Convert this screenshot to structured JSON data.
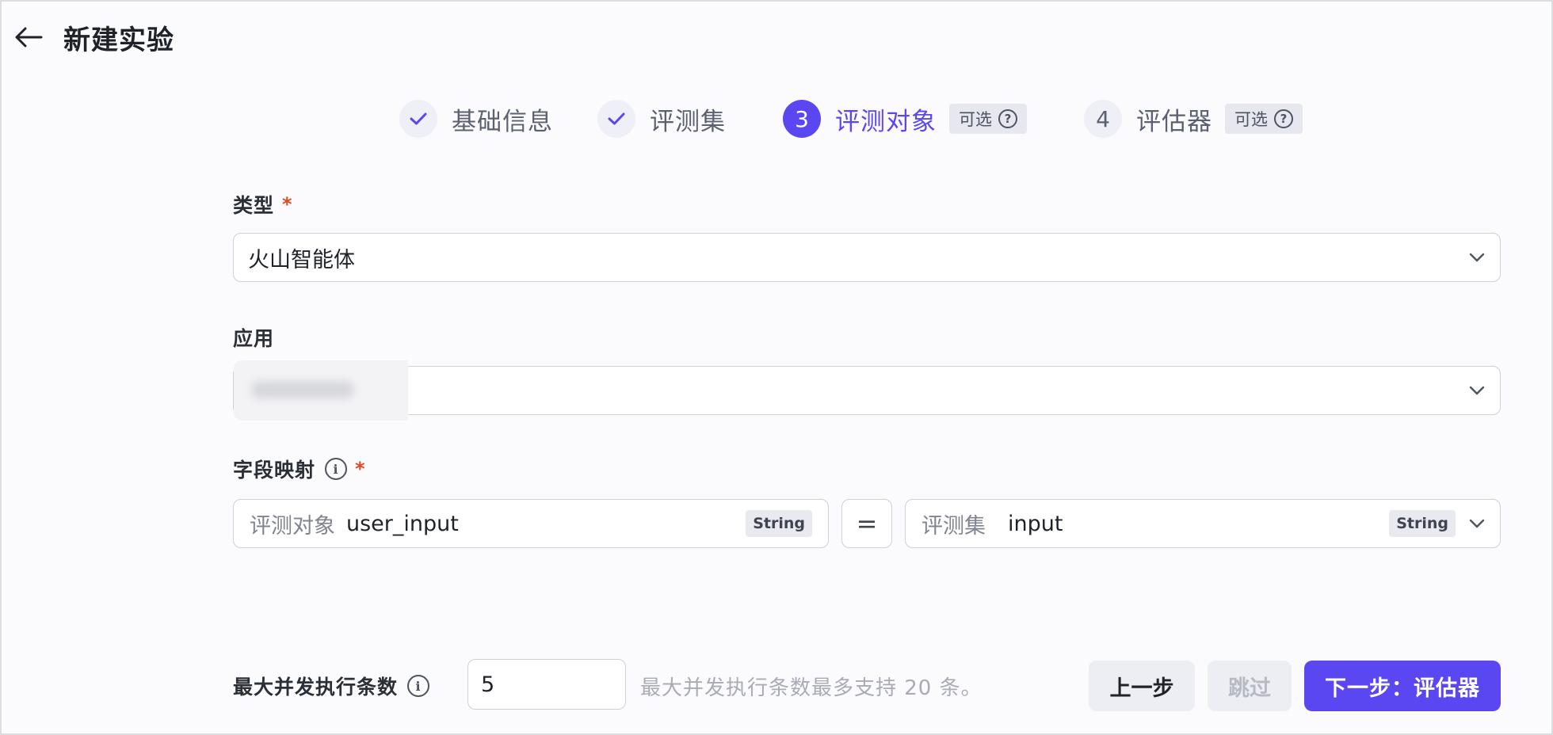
{
  "header": {
    "title": "新建实验",
    "back_icon": "arrow-left-icon"
  },
  "steps": [
    {
      "label": "基础信息",
      "state": "done",
      "marker": ""
    },
    {
      "label": "评测集",
      "state": "done",
      "marker": ""
    },
    {
      "label": "评测对象",
      "state": "active",
      "marker": "3",
      "optional": "可选"
    },
    {
      "label": "评估器",
      "state": "pending",
      "marker": "4",
      "optional": "可选"
    }
  ],
  "form": {
    "type": {
      "label": "类型",
      "required": "*",
      "value": "火山智能体"
    },
    "app": {
      "label": "应用"
    },
    "mapping": {
      "label": "字段映射",
      "required": "*",
      "left_prefix": "评测对象",
      "left_value": "user_input",
      "left_type": "String",
      "equals": "=",
      "right_prefix": "评测集",
      "right_value": "input",
      "right_type": "String"
    }
  },
  "footer": {
    "concurrency_label": "最大并发执行条数",
    "concurrency_value": "5",
    "hint": "最大并发执行条数最多支持 20 条。",
    "prev_label": "上一步",
    "skip_label": "跳过",
    "next_label": "下一步：评估器"
  },
  "colors": {
    "accent": "#5a47f2",
    "required": "#e8451e"
  }
}
